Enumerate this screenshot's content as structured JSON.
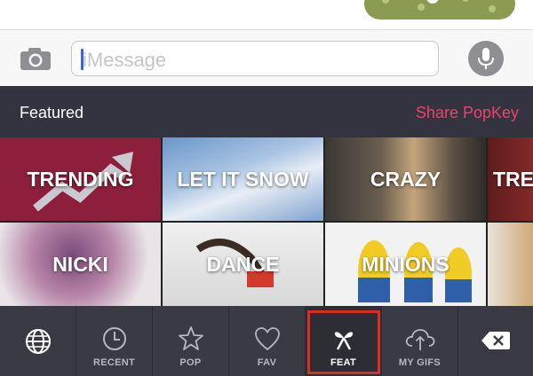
{
  "input": {
    "placeholder": "iMessage",
    "camera_icon": "camera-icon",
    "mic_icon": "microphone-icon"
  },
  "header": {
    "title": "Featured",
    "share_label": "Share PopKey"
  },
  "tiles": [
    {
      "label": "TRENDING"
    },
    {
      "label": "LET IT SNOW"
    },
    {
      "label": "CRAZY"
    },
    {
      "label": "TREA"
    },
    {
      "label": "NICKI"
    },
    {
      "label": "DANCE"
    },
    {
      "label": "MINIONS"
    },
    {
      "label": ""
    }
  ],
  "tabs": [
    {
      "label": "",
      "icon": "globe-icon"
    },
    {
      "label": "RECENT",
      "icon": "clock-icon"
    },
    {
      "label": "POP",
      "icon": "star-icon"
    },
    {
      "label": "FAV",
      "icon": "heart-icon"
    },
    {
      "label": "FEAT",
      "icon": "ribbon-icon",
      "selected": true
    },
    {
      "label": "MY GIFS",
      "icon": "cloud-upload-icon"
    },
    {
      "label": "",
      "icon": "backspace-icon"
    }
  ],
  "colors": {
    "accent": "#e8446c",
    "header_bg": "#343440",
    "tabbar_bg": "#3a3a45",
    "selection_outline": "#e02b20"
  }
}
